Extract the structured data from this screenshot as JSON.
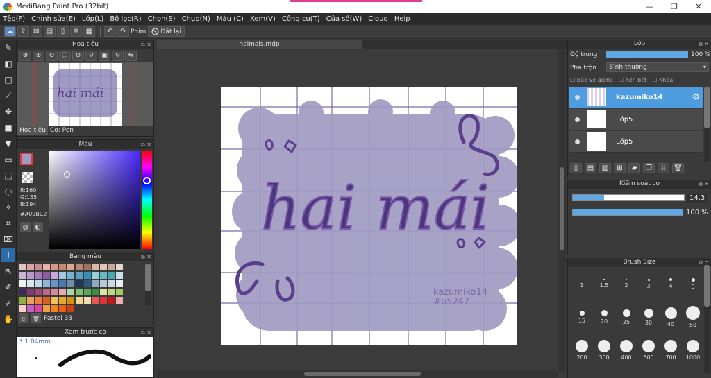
{
  "window": {
    "title": "MediBang Paint Pro (32bit)",
    "minimize": "—",
    "maximize": "❐",
    "close": "✕"
  },
  "menu": [
    "Tệp(F)",
    "Chỉnh sửa(E)",
    "Lớp(L)",
    "Bộ lọc(R)",
    "Chọn(S)",
    "Chụp(N)",
    "Màu (C)",
    "Xem(V)",
    "Công cụ(T)",
    "Cửa sổ(W)",
    "Cloud",
    "Help"
  ],
  "toolbar": {
    "key_label": "Phím",
    "reset_label": "Đặt lại"
  },
  "navigator": {
    "title": "Hoa tiêu",
    "tabs": [
      "Hoa tiêu",
      "Cọ: Pen"
    ]
  },
  "color": {
    "title": "Màu",
    "r": "R:160",
    "g": "G:155",
    "b": "B:194",
    "hex": "#A09BC2",
    "current": "#a09bc2"
  },
  "palette": {
    "title": "Bảng màu",
    "name": "Pastel 33",
    "swatches": [
      "#e8c3c3",
      "#d9a5a5",
      "#c98d8d",
      "#e8b3a5",
      "#d59a8a",
      "#c58a6e",
      "#d8a890",
      "#b88870",
      "#a07060",
      "#d8b8a8",
      "#e0c8b8",
      "#c8a898",
      "#e8d8c8",
      "#c9b4d6",
      "#b89ac8",
      "#a27ab6",
      "#8d5ea3",
      "#c8a8e0",
      "#a0c8e0",
      "#78b0d8",
      "#58a0c8",
      "#3890b8",
      "#98d0d8",
      "#68b8c8",
      "#48a8b8",
      "#c8e0e8",
      "#f0f0f0",
      "#d8e8f0",
      "#c0d8e8",
      "#90b8d8",
      "#6898c8",
      "#4878b0",
      "#7090a8",
      "#203858",
      "#305878",
      "#90a8c0",
      "#b8c8d8",
      "#d0d8e0",
      "#e8eef4",
      "#402858",
      "#803870",
      "#a04878",
      "#c06888",
      "#d88898",
      "#e8a8b0",
      "#a8d8a8",
      "#78c078",
      "#58a858",
      "#389038",
      "#d8e8a0",
      "#c0d880",
      "#a8c860",
      "#90b040",
      "#f0a060",
      "#e88040",
      "#d86020",
      "#f0c060",
      "#e8a830",
      "#d89010",
      "#f0d890",
      "#f0e0b0",
      "#e85858",
      "#d83838",
      "#c01818",
      "#f0b0b0",
      "#f8d0c8",
      "#c060c0",
      "#e040a0",
      "#f0a040",
      "#f08020",
      "#e86010",
      "#d04010"
    ]
  },
  "brush_preview": {
    "title": "Xem trước cọ",
    "size": "* 1.04mm"
  },
  "canvas": {
    "tab": "haimais.mdp",
    "art_text": "hai mái",
    "signature_line1": "kazumiko14",
    "signature_line2": "#b5247"
  },
  "layers": {
    "title": "Lớp",
    "opacity_label": "Độ trong",
    "opacity_value": "100 %",
    "blend_label": "Pha trộn",
    "blend_value": "Bình thường",
    "protect_alpha": "Bảo vệ alpha",
    "clipping": "Xén bớt",
    "lock": "Khóa",
    "items": [
      {
        "name": "kazumiko14",
        "selected": true
      },
      {
        "name": "Lớp5",
        "selected": false
      },
      {
        "name": "Lớp5",
        "selected": false
      }
    ]
  },
  "brush_control": {
    "title": "Kiểm soát cọ",
    "size_value": "14.3",
    "opacity_value": "100 %",
    "size_fraction": 0.28,
    "opacity_fraction": 1.0
  },
  "brush_size": {
    "title": "Brush Size",
    "sizes": [
      "1",
      "1.5",
      "2",
      "3",
      "4",
      "5",
      "15",
      "20",
      "25",
      "30",
      "40",
      "50",
      "200",
      "300",
      "400",
      "500",
      "700",
      "1000"
    ]
  }
}
